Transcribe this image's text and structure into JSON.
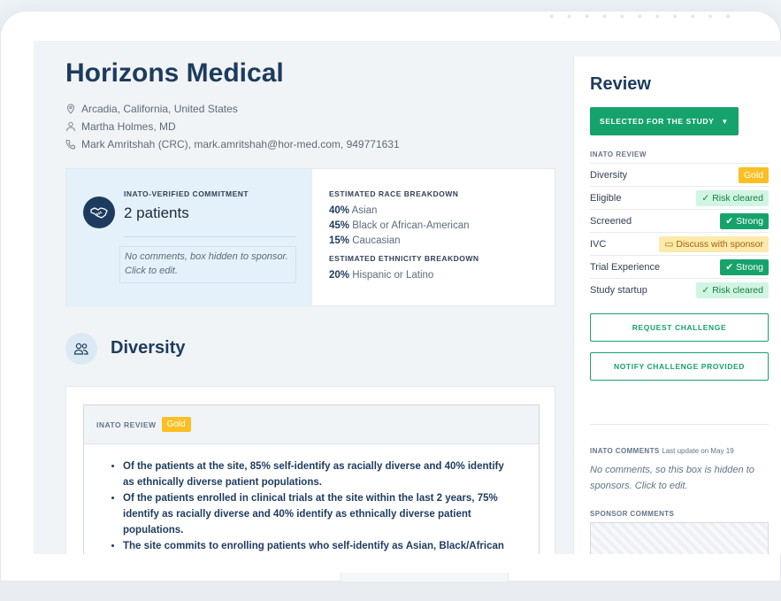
{
  "site": {
    "title": "Horizons Medical",
    "location": "Arcadia, California, United States",
    "investigator": "Martha Holmes, MD",
    "contact": "Mark Amritshah (CRC), mark.amritshah@hor-med.com, 949771631"
  },
  "commitment": {
    "label": "INATO-VERIFIED COMMITMENT",
    "value": "2 patients",
    "comment": "No comments, box hidden to sponsor. Click to edit."
  },
  "race": {
    "heading": "ESTIMATED RACE BREAKDOWN",
    "rows": [
      {
        "pct": "40%",
        "label": "Asian"
      },
      {
        "pct": "45%",
        "label": "Black or African-American"
      },
      {
        "pct": "15%",
        "label": "Caucasian"
      }
    ]
  },
  "ethnicity": {
    "heading": "ESTIMATED ETHNICITY BREAKDOWN",
    "rows": [
      {
        "pct": "20%",
        "label": "Hispanic or Latino"
      }
    ]
  },
  "diversity": {
    "title": "Diversity",
    "review_label": "INATO REVIEW",
    "badge": "Gold",
    "bullets": [
      "Of the patients at the site, 85% self-identify as racially diverse and 40% identify as ethnically diverse patient populations.",
      "Of the patients enrolled in clinical trials at the site within the last 2 years, 75% identify as racially diverse and 40% identify as ethnically diverse patient populations.",
      "The site commits to enrolling patients who self-identify as Asian, Black/African American, White, and Hispanic/Latino."
    ]
  },
  "review": {
    "title": "Review",
    "status_button": "SELECTED FOR THE STUDY",
    "inato_label": "INATO REVIEW",
    "rows": [
      {
        "name": "Diversity",
        "badge": "Gold",
        "kind": "gold"
      },
      {
        "name": "Eligible",
        "badge": "Risk cleared",
        "kind": "cleared"
      },
      {
        "name": "Screened",
        "badge": "Strong",
        "kind": "strong"
      },
      {
        "name": "IVC",
        "badge": "Discuss with sponsor",
        "kind": "discuss"
      },
      {
        "name": "Trial Experience",
        "badge": "Strong",
        "kind": "strong"
      },
      {
        "name": "Study startup",
        "badge": "Risk cleared",
        "kind": "cleared"
      }
    ],
    "request_button": "REQUEST CHALLENGE",
    "notify_button": "NOTIFY CHALLENGE PROVIDED",
    "comments_label": "INATO COMMENTS",
    "comments_update": "Last update on May 19",
    "comments_text": "No comments, so this box is hidden to sponsors. Click to edit.",
    "sponsor_label": "SPONSOR COMMENTS"
  },
  "colors": {
    "accent": "#16a36b",
    "navy": "#1d3b5e",
    "gold": "#fbbf24"
  }
}
